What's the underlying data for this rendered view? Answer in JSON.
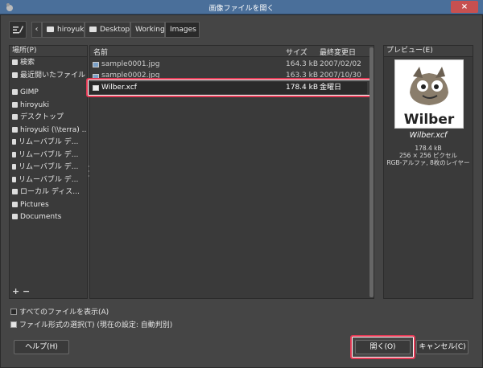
{
  "window": {
    "title": "画像ファイルを開く",
    "close": "×"
  },
  "breadcrumb": [
    "hiroyuki",
    "Desktop",
    "Working",
    "Images"
  ],
  "places": {
    "header": "場所(P)",
    "items": [
      "検索",
      "最近開いたファイル",
      "GIMP",
      "hiroyuki",
      "デスクトップ",
      "hiroyuki (\\\\terra) ...",
      "リムーバブル デ...",
      "リムーバブル デ...",
      "リムーバブル デ...",
      "リムーバブル デ...",
      "ローカル ディス...",
      "Pictures",
      "Documents"
    ],
    "add_remove": "+ −"
  },
  "files": {
    "columns": {
      "name": "名前",
      "size": "サイズ",
      "modified": "最終変更日"
    },
    "rows": [
      {
        "name": "sample0001.jpg",
        "size": "164.3 kB",
        "modified": "2007/02/02"
      },
      {
        "name": "sample0002.jpg",
        "size": "163.3 kB",
        "modified": "2007/10/30"
      },
      {
        "name": "Wilber.xcf",
        "size": "178.4 kB",
        "modified": "金曜日"
      }
    ]
  },
  "preview": {
    "header": "プレビュー(E)",
    "thumb_text": "Wilber",
    "filename": "Wilber.xcf",
    "info": [
      "178.4 kB",
      "256 × 256 ピクセル",
      "RGB-アルファ, 8枚のレイヤー"
    ]
  },
  "options": {
    "show_all": "すべてのファイルを表示(A)",
    "file_type": "ファイル形式の選択(T)",
    "file_type_current": "(現在の設定: 自動判別)"
  },
  "buttons": {
    "help": "ヘルプ(H)",
    "open": "開く(O)",
    "cancel": "キャンセル(C)"
  },
  "colors": {
    "highlight": "#e23a55",
    "title_bar": "#4a6f9a"
  }
}
